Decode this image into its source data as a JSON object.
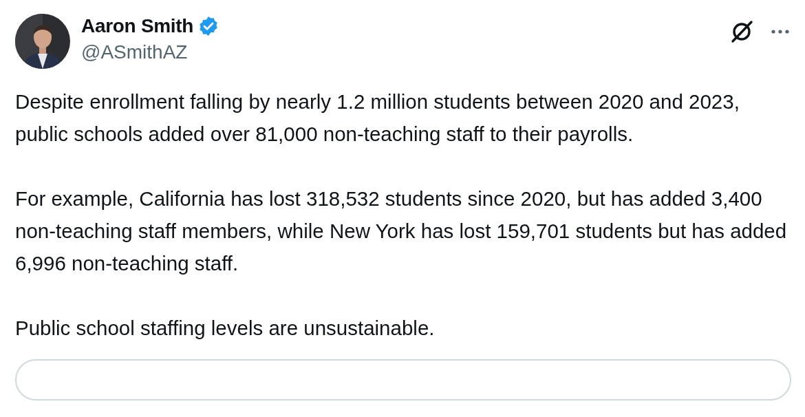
{
  "author": {
    "name": "Aaron Smith",
    "verified": true,
    "handle": "@ASmithAZ"
  },
  "paragraphs": [
    "Despite enrollment falling by nearly 1.2 million students between 2020 and 2023, public schools added over 81,000 non-teaching staff to their payrolls.",
    "For example, California has lost 318,532 students since 2020, but has added 3,400 non-teaching staff members, while New York has lost 159,701 students but has added 6,996 non-teaching staff.",
    "Public school staffing levels are unsustainable."
  ]
}
